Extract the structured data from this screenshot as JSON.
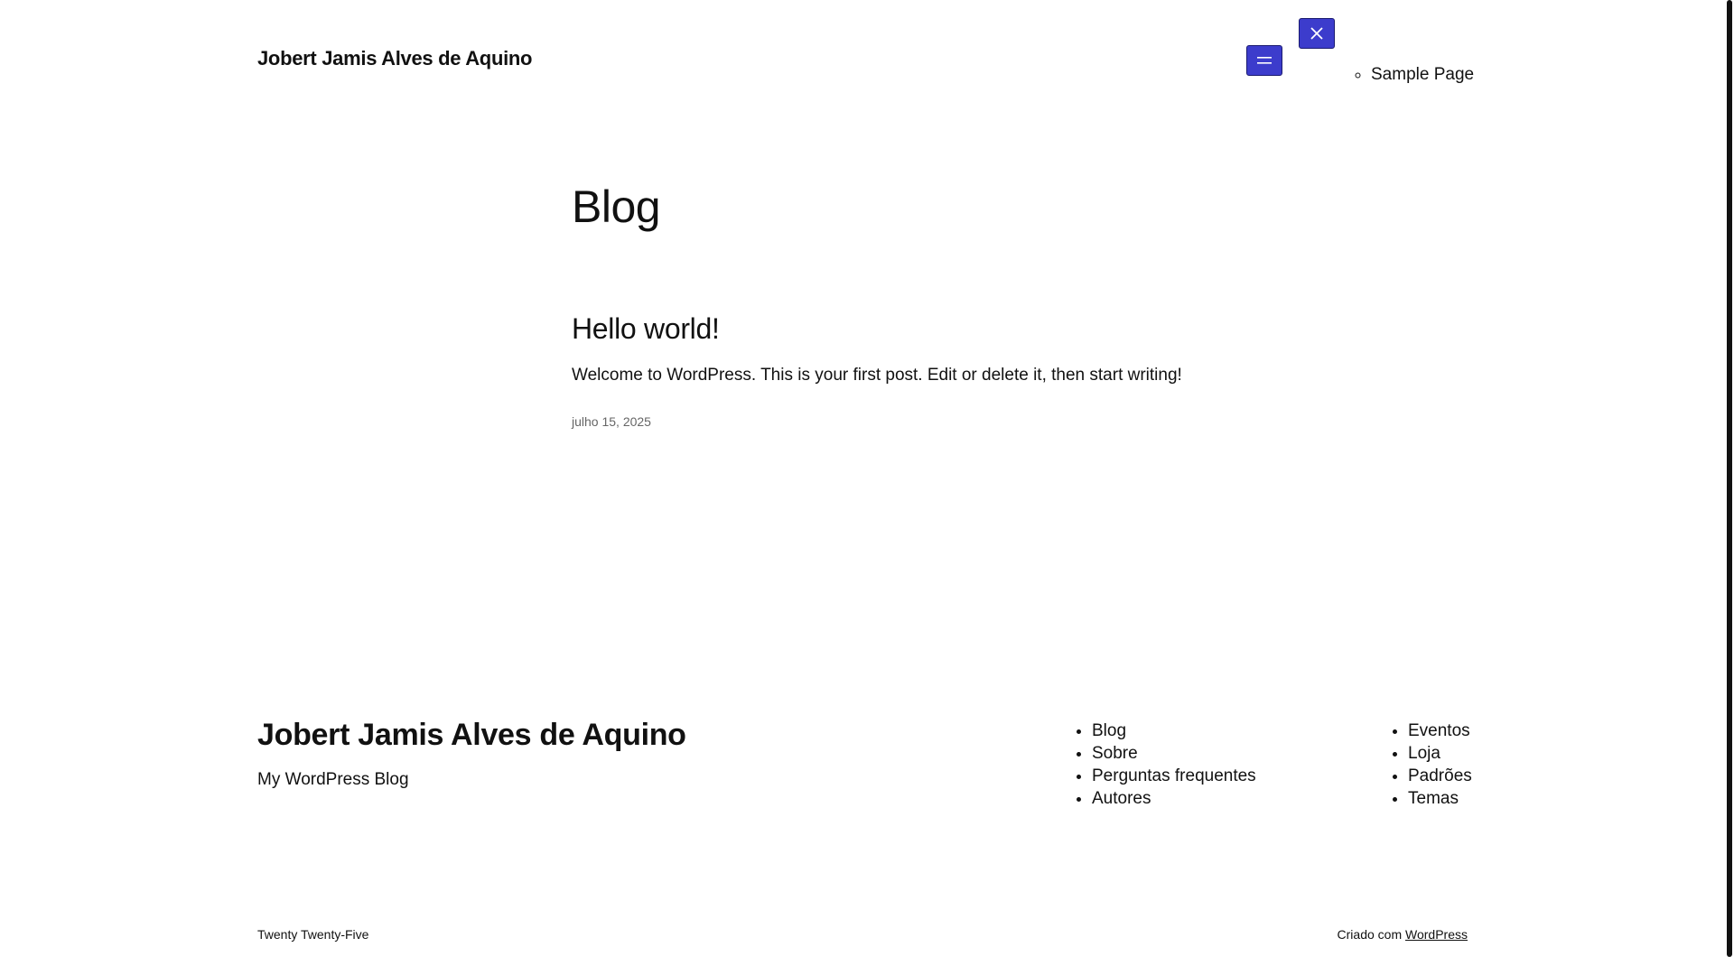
{
  "header": {
    "site_title": "Jobert Jamis Alves de Aquino",
    "nav_items": [
      "Sample Page"
    ]
  },
  "main": {
    "heading": "Blog",
    "posts": [
      {
        "title": "Hello world!",
        "excerpt": "Welcome to WordPress. This is your first post. Edit or delete it, then start writing!",
        "date": "julho 15, 2025"
      }
    ]
  },
  "footer": {
    "site_title": "Jobert Jamis Alves de Aquino",
    "tagline": "My WordPress Blog",
    "nav_col_1": [
      "Blog",
      "Sobre",
      "Perguntas frequentes",
      "Autores"
    ],
    "nav_col_2": [
      "Eventos",
      "Loja",
      "Padrões",
      "Temas"
    ],
    "theme_name": "Twenty Twenty-Five",
    "credit_prefix": "Criado com",
    "credit_link": "WordPress"
  },
  "icons": {
    "menu_open": "hamburger-icon",
    "menu_close": "close-icon"
  },
  "colors": {
    "button_bg": "#3c3ccc",
    "text": "#111111",
    "muted": "#666666"
  }
}
